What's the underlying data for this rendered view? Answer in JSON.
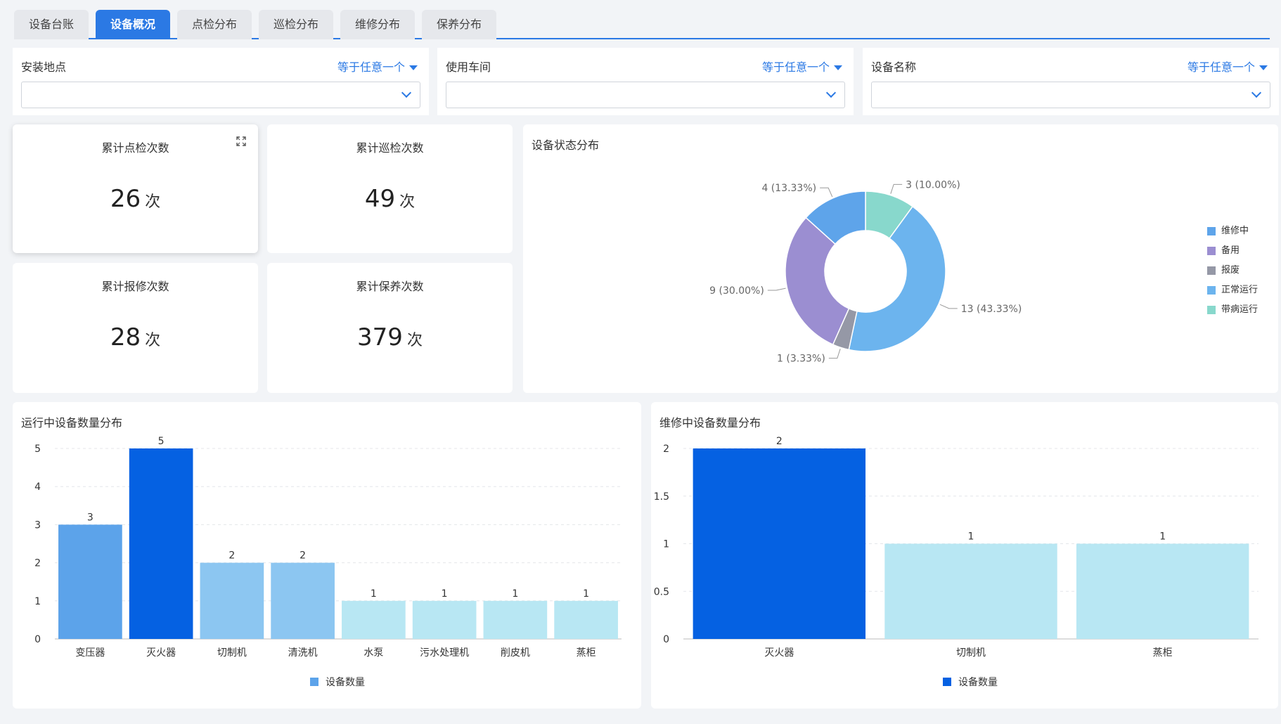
{
  "tabs": [
    {
      "label": "设备台账"
    },
    {
      "label": "设备概况"
    },
    {
      "label": "点检分布"
    },
    {
      "label": "巡检分布"
    },
    {
      "label": "维修分布"
    },
    {
      "label": "保养分布"
    }
  ],
  "active_tab": 1,
  "filters": [
    {
      "label": "安装地点",
      "operator": "等于任意一个",
      "value": ""
    },
    {
      "label": "使用车间",
      "operator": "等于任意一个",
      "value": ""
    },
    {
      "label": "设备名称",
      "operator": "等于任意一个",
      "value": ""
    }
  ],
  "kpis": [
    {
      "title": "累计点检次数",
      "value": "26",
      "unit": "次"
    },
    {
      "title": "累计巡检次数",
      "value": "49",
      "unit": "次"
    },
    {
      "title": "累计报修次数",
      "value": "28",
      "unit": "次"
    },
    {
      "title": "累计保养次数",
      "value": "379",
      "unit": "次"
    }
  ],
  "colors": {
    "accent": "#2b79e4",
    "repairing": "#5ea4ea",
    "standby": "#9b8ed1",
    "scrapped": "#9598a6",
    "normal": "#6cb4ee",
    "faulty": "#88d8cc",
    "bar_dark": "#0561e2",
    "bar_mid": "#5ca3ea",
    "bar_light_mid": "#8cc6f1",
    "bar_light": "#b8e7f3"
  },
  "icons": {
    "expand": "expand-icon",
    "chevron": "chevron-down-icon",
    "dropdown": "triangle-down-icon"
  },
  "chart_data": [
    {
      "type": "pie",
      "variant": "donut",
      "title": "设备状态分布",
      "legend_position": "right",
      "legend": [
        "维修中",
        "备用",
        "报废",
        "正常运行",
        "带病运行"
      ],
      "slices": [
        {
          "name": "带病运行",
          "value": 3,
          "label": "3 (10.00%)"
        },
        {
          "name": "正常运行",
          "value": 13,
          "label": "13 (43.33%)"
        },
        {
          "name": "报废",
          "value": 1,
          "label": "1 (3.33%)"
        },
        {
          "name": "备用",
          "value": 9,
          "label": "9 (30.00%)"
        },
        {
          "name": "维修中",
          "value": 4,
          "label": "4 (13.33%)"
        }
      ]
    },
    {
      "type": "bar",
      "title": "运行中设备数量分布",
      "categories": [
        "变压器",
        "灭火器",
        "切制机",
        "清洗机",
        "水泵",
        "污水处理机",
        "削皮机",
        "蒸柜"
      ],
      "values": [
        3,
        5,
        2,
        2,
        1,
        1,
        1,
        1
      ],
      "series_name": "设备数量",
      "yticks": [
        "0",
        "1",
        "2",
        "3",
        "4",
        "5"
      ],
      "ylim": [
        0,
        5
      ],
      "grid": true,
      "legend_position": "bottom"
    },
    {
      "type": "bar",
      "title": "维修中设备数量分布",
      "categories": [
        "灭火器",
        "切制机",
        "蒸柜"
      ],
      "values": [
        2,
        1,
        1
      ],
      "series_name": "设备数量",
      "yticks": [
        "0",
        "0.5",
        "1",
        "1.5",
        "2"
      ],
      "ylim": [
        0,
        2
      ],
      "grid": true,
      "legend_position": "bottom"
    }
  ]
}
